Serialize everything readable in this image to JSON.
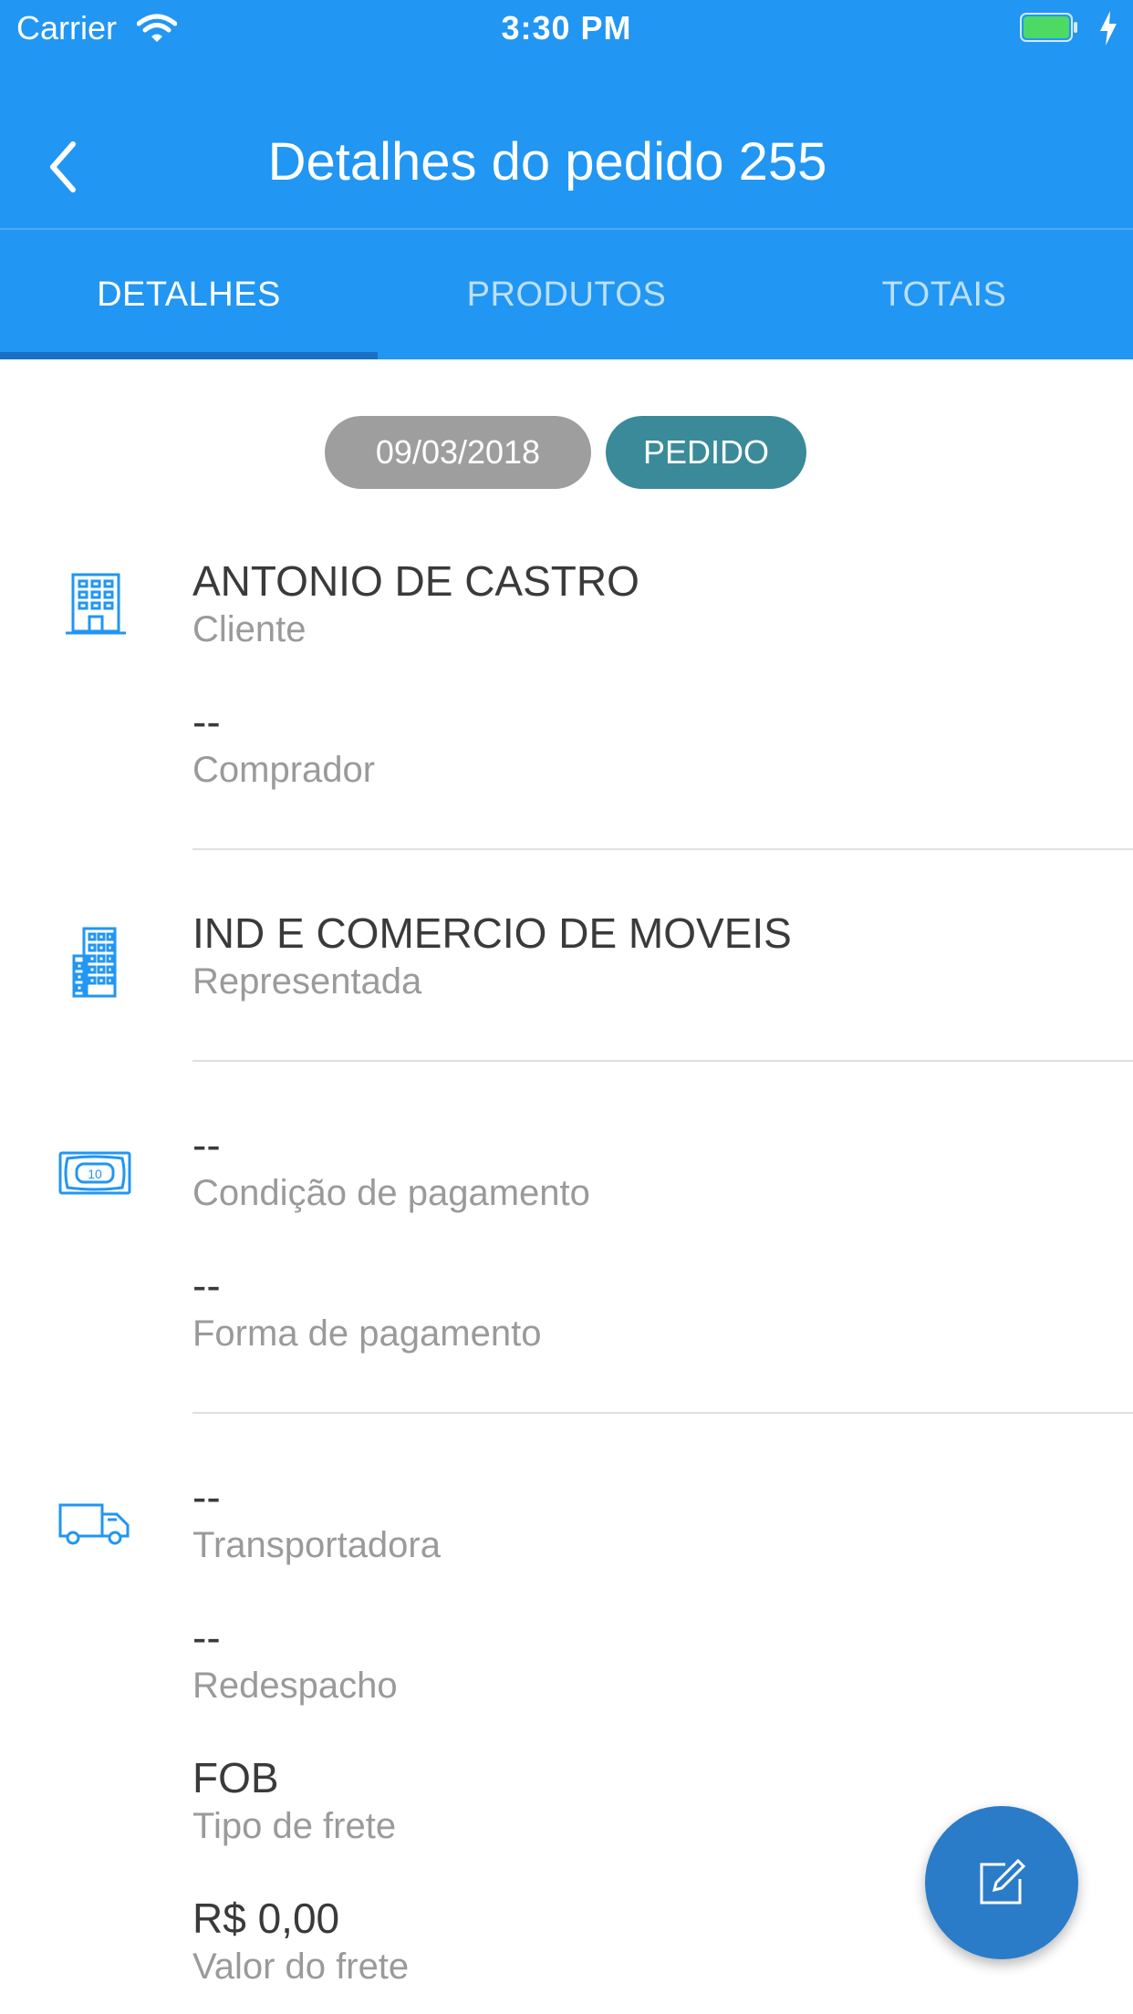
{
  "status_bar": {
    "carrier": "Carrier",
    "time": "3:30 PM"
  },
  "header": {
    "title": "Detalhes do pedido 255"
  },
  "tabs": [
    {
      "label": "DETALHES",
      "active": true
    },
    {
      "label": "PRODUTOS",
      "active": false
    },
    {
      "label": "TOTAIS",
      "active": false
    }
  ],
  "chips": {
    "date": "09/03/2018",
    "status": "PEDIDO"
  },
  "sections": {
    "cliente": {
      "icon": "building-icon",
      "value": "ANTONIO DE CASTRO",
      "label": "Cliente",
      "comprador_value": "--",
      "comprador_label": "Comprador"
    },
    "representada": {
      "icon": "office-tower-icon",
      "value": "IND E COMERCIO DE MOVEIS",
      "label": "Representada"
    },
    "pagamento": {
      "icon": "banknote-icon",
      "banknote_text": "10",
      "condicao_value": "--",
      "condicao_label": "Condição de pagamento",
      "forma_value": "--",
      "forma_label": "Forma de pagamento"
    },
    "frete": {
      "icon": "truck-icon",
      "transportadora_value": "--",
      "transportadora_label": "Transportadora",
      "redespacho_value": "--",
      "redespacho_label": "Redespacho",
      "tipo_value": "FOB",
      "tipo_label": "Tipo de frete",
      "valor_value": "R$ 0,00",
      "valor_label": "Valor do frete"
    }
  },
  "fab": {
    "icon": "edit-icon"
  },
  "colors": {
    "primary": "#2196f3",
    "tab_indicator": "#1a6fc4",
    "chip_date": "#9e9e9e",
    "chip_status": "#3a8a99",
    "fab": "#2a7cc8",
    "icon": "#2196f3"
  }
}
